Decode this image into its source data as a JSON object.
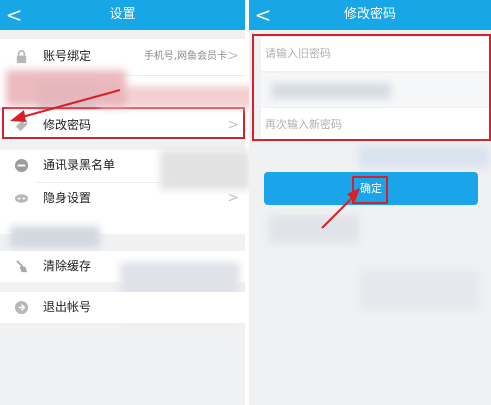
{
  "left_screen": {
    "title": "设置",
    "items": {
      "account_binding": {
        "label": "账号绑定",
        "value": "手机号,网鱼会员卡"
      },
      "change_password": {
        "label": "修改密码"
      },
      "blacklist": {
        "label": "通讯录黑名单"
      },
      "privacy": {
        "label": "隐身设置"
      },
      "clear_cache": {
        "label": "清除缓存"
      },
      "logout": {
        "label": "退出帐号"
      }
    }
  },
  "right_screen": {
    "title": "修改密码",
    "old_password_placeholder": "请输入旧密码",
    "confirm_password_placeholder": "再次输入新密码",
    "confirm_button": "确定"
  },
  "glyphs": {
    "back": "<",
    "chevron": ">"
  },
  "colors": {
    "header": "#18a7e6",
    "button": "#1aa5ea",
    "annotation": "#d8202a"
  }
}
